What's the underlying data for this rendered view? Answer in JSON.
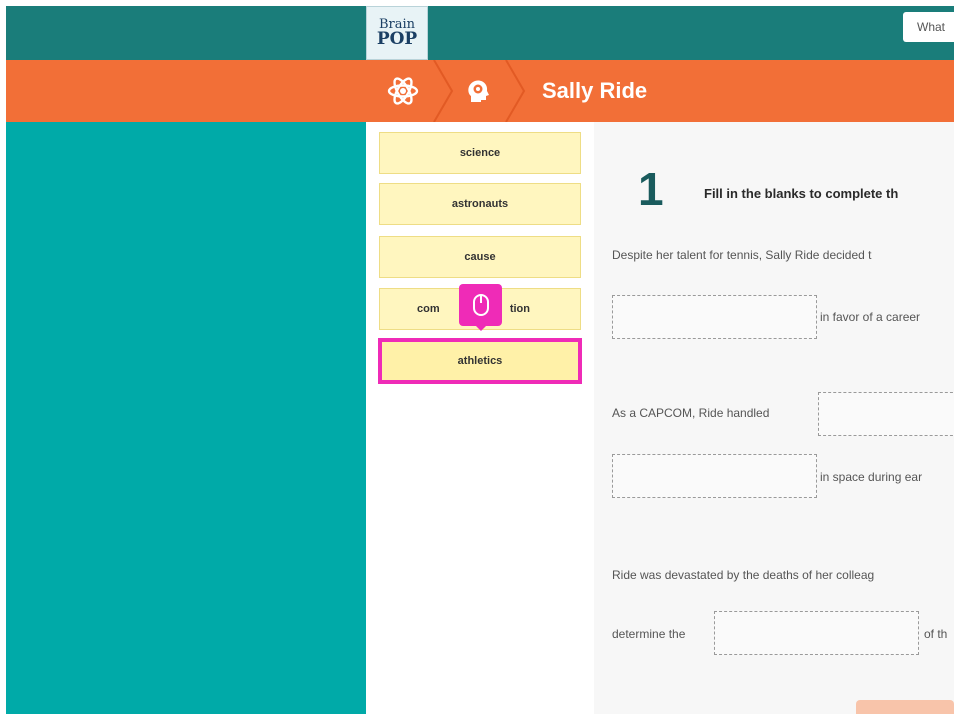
{
  "header": {
    "logo_top": "Brain",
    "logo_bottom": "POP",
    "search_placeholder": "What"
  },
  "breadcrumb": {
    "icons": [
      "atom-icon",
      "head-icon"
    ],
    "title": "Sally Ride"
  },
  "word_bank": {
    "words": [
      "science",
      "astronauts",
      "cause",
      "communication",
      "athletics"
    ],
    "occluded_label_left": "com",
    "occluded_label_right": "tion",
    "selected": "athletics"
  },
  "question": {
    "number": "1",
    "instruction": "Fill in the blanks to complete th",
    "sentence1": "Despite her talent for tennis, Sally Ride decided t",
    "sentence1_after": "in favor of a career",
    "sentence2": "As a CAPCOM, Ride handled",
    "sentence2_after": "in space during ear",
    "sentence3": "Ride was devastated by the deaths of her colleag",
    "sentence3_before": "determine the",
    "sentence3_after": "of th"
  },
  "colors": {
    "topbar": "#1a7d7a",
    "orange": "#f26f37",
    "teal": "#00aaa8",
    "tile": "#fff6bf",
    "highlight": "#ef2bb7"
  }
}
